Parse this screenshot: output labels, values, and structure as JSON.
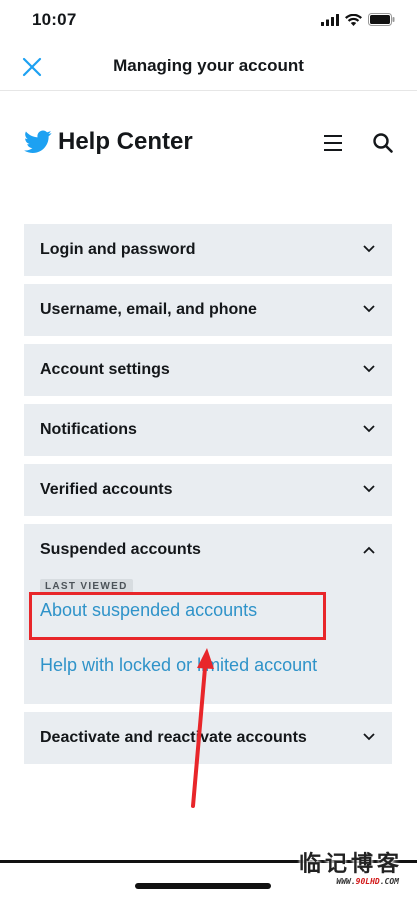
{
  "status_bar": {
    "time": "10:07"
  },
  "nav": {
    "title": "Managing your account"
  },
  "help_header": {
    "title": "Help Center"
  },
  "accordion": {
    "items": [
      {
        "label": "Login and password"
      },
      {
        "label": "Username, email, and phone"
      },
      {
        "label": "Account settings"
      },
      {
        "label": "Notifications"
      },
      {
        "label": "Verified accounts"
      },
      {
        "label": "Suspended accounts",
        "expanded": true,
        "badge": "LAST VIEWED",
        "links": [
          "About suspended accounts",
          "Help with locked or limited account"
        ]
      },
      {
        "label": "Deactivate and reactivate accounts"
      }
    ]
  },
  "watermark": {
    "brand": "临记博客",
    "url_prefix": "WWW.",
    "url_brand": "90LHD",
    "url_suffix": ".COM"
  },
  "colors": {
    "link": "#2f93c9",
    "twitter_blue": "#1da1f2",
    "annotation_red": "#e8262a",
    "panel_bg": "#e9edf1"
  },
  "icons": {
    "close": "close-icon",
    "bird": "twitter-bird-icon",
    "menu": "hamburger-menu-icon",
    "search": "search-icon",
    "chevron_down": "chevron-down-icon",
    "chevron_up": "chevron-up-icon"
  }
}
